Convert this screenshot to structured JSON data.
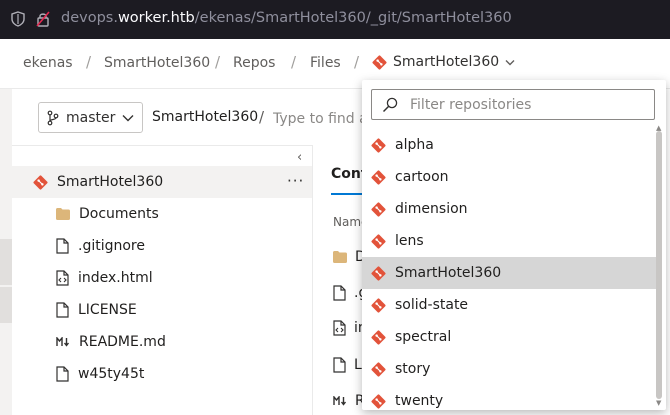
{
  "browser": {
    "url_prefix": "devops.",
    "url_host": "worker.htb",
    "url_path": "/ekenas/SmartHotel360/_git/SmartHotel360"
  },
  "breadcrumb": {
    "items": [
      "ekenas",
      "SmartHotel360",
      "Repos",
      "Files"
    ],
    "current_repo": "SmartHotel360",
    "separator": "/"
  },
  "toolbar": {
    "branch": "master",
    "path_repo": "SmartHotel360",
    "path_separator": "/",
    "path_placeholder": "Type to find a file or folder..."
  },
  "tree": {
    "collapse_glyph": "‹",
    "root": "SmartHotel360",
    "more_glyph": "···",
    "items": [
      {
        "name": "Documents",
        "icon": "folder-icon"
      },
      {
        "name": ".gitignore",
        "icon": "file-icon"
      },
      {
        "name": "index.html",
        "icon": "code-file-icon"
      },
      {
        "name": "LICENSE",
        "icon": "file-icon"
      },
      {
        "name": "README.md",
        "icon": "markdown-icon"
      },
      {
        "name": "w45ty45t",
        "icon": "file-icon"
      }
    ]
  },
  "content": {
    "tab": "Cont",
    "column_name": "Name",
    "rows": [
      "D",
      ".g",
      "in",
      "LI",
      "R"
    ]
  },
  "dropdown": {
    "filter_placeholder": "Filter repositories",
    "items": [
      "alpha",
      "cartoon",
      "dimension",
      "lens",
      "SmartHotel360",
      "solid-state",
      "spectral",
      "story",
      "twenty"
    ],
    "selected": "SmartHotel360"
  },
  "colors": {
    "git_icon": "#e2533a",
    "folder": "#dcb67a",
    "accent": "#0078d4",
    "selected_row": "#d6d6d6"
  }
}
